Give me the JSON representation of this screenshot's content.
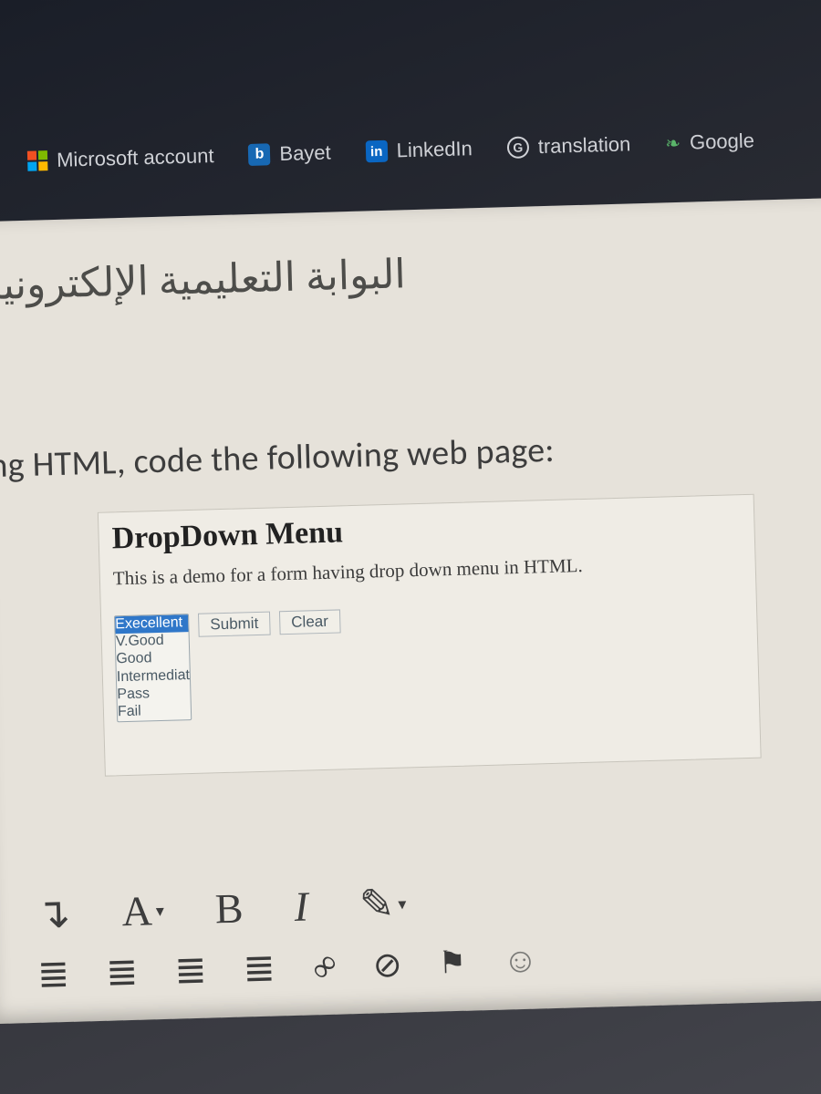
{
  "bookmarks": {
    "microsoft": "Microsoft account",
    "bayet": "Bayet",
    "linkedin": "LinkedIn",
    "translation": "translation",
    "google": "Google"
  },
  "page": {
    "portal_title": "البوابة التعليمية الإلكترونية",
    "question": "ing HTML, code the following web page:",
    "demo": {
      "heading": "DropDown Menu",
      "desc": "This is a demo for a form having drop down menu in HTML.",
      "options": [
        "Execellent",
        "V.Good",
        "Good",
        "Intermediat",
        "Pass",
        "Fail"
      ],
      "submit": "Submit",
      "clear": "Clear"
    }
  },
  "toolbar": {
    "arrow": "↴",
    "font": "A",
    "bold": "B",
    "italic": "I",
    "brush": "✎",
    "ul": "≣",
    "ol": "≣",
    "outdent": "≣",
    "indent": "≣",
    "link": "∞",
    "unlink": "⊘",
    "flag": "⚑",
    "smile": "☺"
  }
}
